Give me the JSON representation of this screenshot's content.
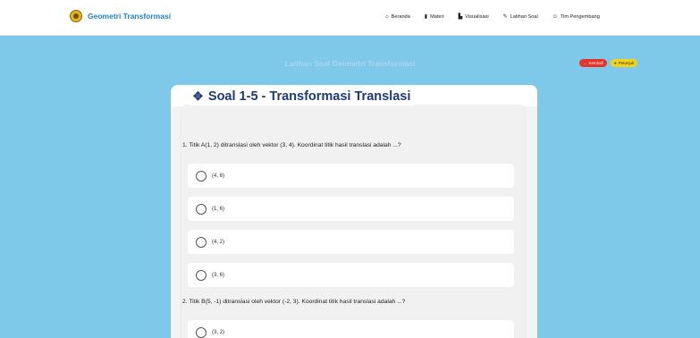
{
  "brand": {
    "title": "Geometri Transformasi"
  },
  "nav": [
    {
      "icon": "house-icon",
      "glyph": "⌂",
      "label": "Beranda"
    },
    {
      "icon": "book-icon",
      "glyph": "▮",
      "label": "Materi"
    },
    {
      "icon": "chart-icon",
      "glyph": "▙",
      "label": "Visualisasi"
    },
    {
      "icon": "pencil-icon",
      "glyph": "✎",
      "label": "Latihan Soal"
    },
    {
      "icon": "people-icon",
      "glyph": "☺",
      "label": "Tim Pengembang"
    }
  ],
  "page": {
    "header_title": "Latihan Soal Geometri Transformasi",
    "kembali_label": "Kembali",
    "petunjuk_label": "Petunjuk"
  },
  "section": {
    "title": "Soal 1-5 - Transformasi Translasi"
  },
  "questions": [
    {
      "text": "1. Titik A(1, 2) ditranslasi oleh vektor (3, 4). Koordinat titik hasil translasi adalah ...?",
      "options": [
        "(4, 6)",
        "(1, 6)",
        "(4, 2)",
        "(3, 6)"
      ]
    },
    {
      "text": "2. Titik B(5, -1) ditranslasi oleh vektor (-2, 3). Koordinat titik hasil translasi adalah ...?",
      "options": [
        "(3, 2)"
      ]
    }
  ],
  "colors": {
    "background": "#7ec9ea",
    "brand": "#1d82cf",
    "title": "#1e3a78",
    "kembali": "#e5332a",
    "petunjuk": "#f3d21b"
  }
}
